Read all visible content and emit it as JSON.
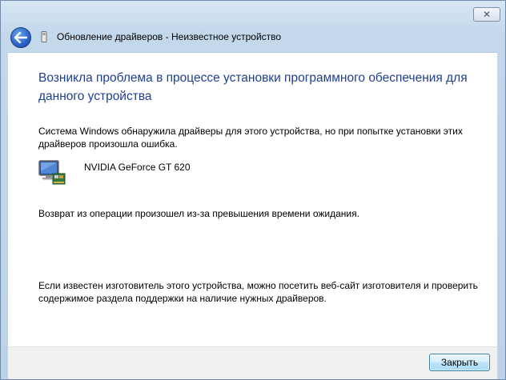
{
  "window": {
    "title": "Обновление драйверов - Неизвестное устройство",
    "close_glyph": "✕"
  },
  "content": {
    "heading": "Возникла проблема в процессе установки программного обеспечения для данного устройства",
    "description": "Система Windows обнаружила драйверы для этого устройства, но при попытке установки этих драйверов произошла ошибка.",
    "device_name": "NVIDIA GeForce GT 620",
    "error_message": "Возврат из операции произошел из-за превышения времени ожидания.",
    "help_text": "Если известен изготовитель этого устройства, можно посетить веб-сайт изготовителя и проверить содержимое раздела поддержки на наличие нужных драйверов."
  },
  "footer": {
    "close_button": "Закрыть"
  },
  "icons": {
    "back": "back-arrow-icon",
    "device_small": "device-icon",
    "display_adapter": "display-adapter-icon"
  },
  "colors": {
    "heading": "#1f3f8f",
    "button_border": "#3c7fb1"
  }
}
